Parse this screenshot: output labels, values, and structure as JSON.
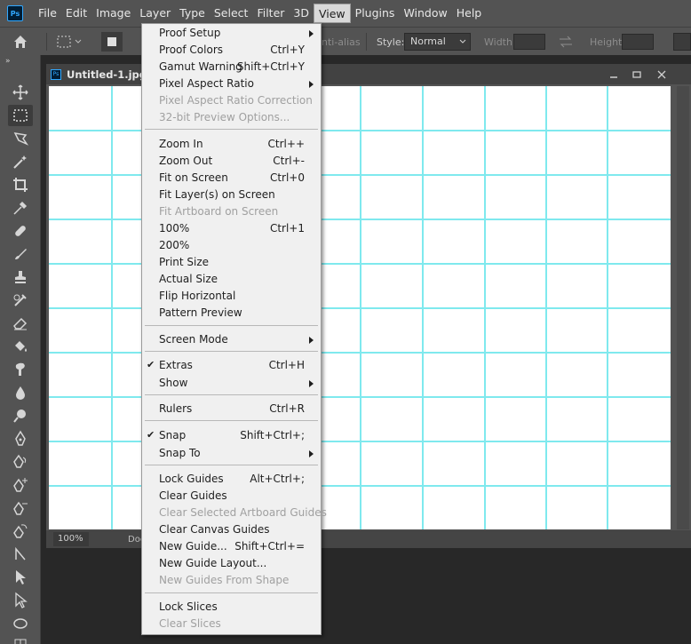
{
  "app": {
    "logo_text": "Ps",
    "menus": [
      "File",
      "Edit",
      "Image",
      "Layer",
      "Type",
      "Select",
      "Filter",
      "3D",
      "View",
      "Plugins",
      "Window",
      "Help"
    ],
    "active_menu": "View"
  },
  "options_bar": {
    "anti_alias_label": "nti-alias",
    "style_label": "Style:",
    "style_value": "Normal",
    "width_label": "Width:",
    "height_label": "Height:"
  },
  "document": {
    "title": "Untitled-1.jpg @",
    "zoom": "100%",
    "info": "Doc"
  },
  "view_menu": {
    "items": [
      {
        "label": "Proof Setup",
        "submenu": true
      },
      {
        "label": "Proof Colors",
        "shortcut": "Ctrl+Y"
      },
      {
        "label": "Gamut Warning",
        "shortcut": "Shift+Ctrl+Y"
      },
      {
        "label": "Pixel Aspect Ratio",
        "submenu": true
      },
      {
        "label": "Pixel Aspect Ratio Correction",
        "disabled": true
      },
      {
        "label": "32-bit Preview Options...",
        "disabled": true
      },
      {
        "label": "Zoom In",
        "shortcut": "Ctrl++"
      },
      {
        "label": "Zoom Out",
        "shortcut": "Ctrl+-"
      },
      {
        "label": "Fit on Screen",
        "shortcut": "Ctrl+0"
      },
      {
        "label": "Fit Layer(s) on Screen"
      },
      {
        "label": "Fit Artboard on Screen",
        "disabled": true
      },
      {
        "label": "100%",
        "shortcut": "Ctrl+1"
      },
      {
        "label": "200%"
      },
      {
        "label": "Print Size"
      },
      {
        "label": "Actual Size"
      },
      {
        "label": "Flip Horizontal"
      },
      {
        "label": "Pattern Preview"
      },
      {
        "label": "Screen Mode",
        "submenu": true
      },
      {
        "label": "Extras",
        "shortcut": "Ctrl+H",
        "checked": true
      },
      {
        "label": "Show",
        "submenu": true
      },
      {
        "label": "Rulers",
        "shortcut": "Ctrl+R"
      },
      {
        "label": "Snap",
        "shortcut": "Shift+Ctrl+;",
        "checked": true
      },
      {
        "label": "Snap To",
        "submenu": true
      },
      {
        "label": "Lock Guides",
        "shortcut": "Alt+Ctrl+;"
      },
      {
        "label": "Clear Guides"
      },
      {
        "label": "Clear Selected Artboard Guides",
        "disabled": true
      },
      {
        "label": "Clear Canvas Guides"
      },
      {
        "label": "New Guide...",
        "shortcut": "Shift+Ctrl+="
      },
      {
        "label": "New Guide Layout..."
      },
      {
        "label": "New Guides From Shape",
        "disabled": true
      },
      {
        "label": "Lock Slices"
      },
      {
        "label": "Clear Slices",
        "disabled": true
      }
    ]
  },
  "icons": {
    "home": "home-icon",
    "marquee": "rect-marquee-icon",
    "check": "✔"
  },
  "colors": {
    "guide": "#7fe9ee",
    "menu_bg": "#f0f0f0",
    "ui_bg": "#535353"
  }
}
